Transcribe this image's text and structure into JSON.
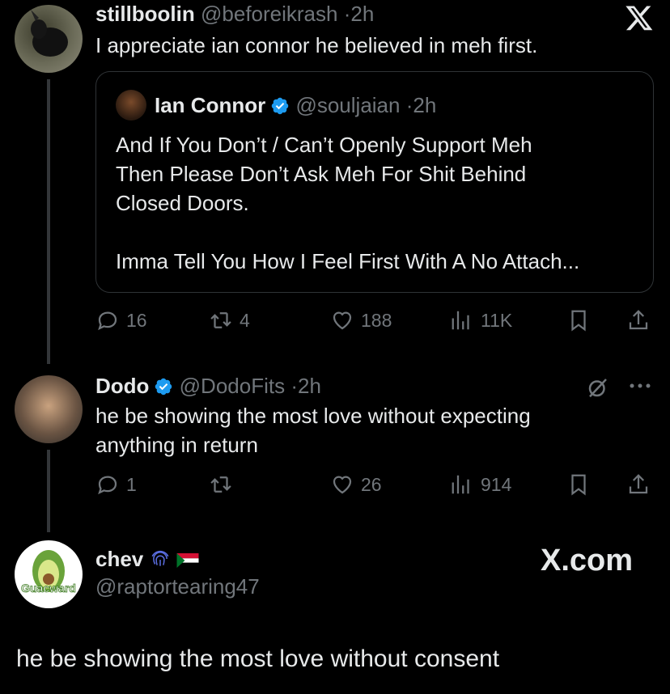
{
  "tweet1": {
    "display_name": "stillboolin",
    "handle": "@beforeikrash",
    "time": "2h",
    "text": "I appreciate ian connor he believed in meh first.",
    "quote": {
      "display_name": "Ian Connor",
      "handle": "@souljaian",
      "time": "2h",
      "line1": "And If You Don’t / Can’t Openly Support Meh",
      "line2": "Then Please Don’t Ask Meh For Shit Behind",
      "line3": "Closed Doors.",
      "line4": "Imma Tell You How I Feel First With A No Attach..."
    },
    "actions": {
      "replies": "16",
      "reposts": "4",
      "likes": "188",
      "views": "11K"
    }
  },
  "tweet2": {
    "display_name": "Dodo",
    "handle": "@DodoFits",
    "time": "2h",
    "line1": "he be showing the most love without expecting",
    "line2": "anything in return",
    "actions": {
      "replies": "1",
      "reposts": "",
      "likes": "26",
      "views": "914"
    }
  },
  "tweet3": {
    "display_name": "chev",
    "handle": "@raptortearing47",
    "avatar_text": "Guacward",
    "text": "he be showing the most love without consent"
  },
  "watermark": "X.com",
  "separator": "·",
  "colors": {
    "verified": "#1d9bf0",
    "muted": "#71767b",
    "bg": "#000000"
  }
}
